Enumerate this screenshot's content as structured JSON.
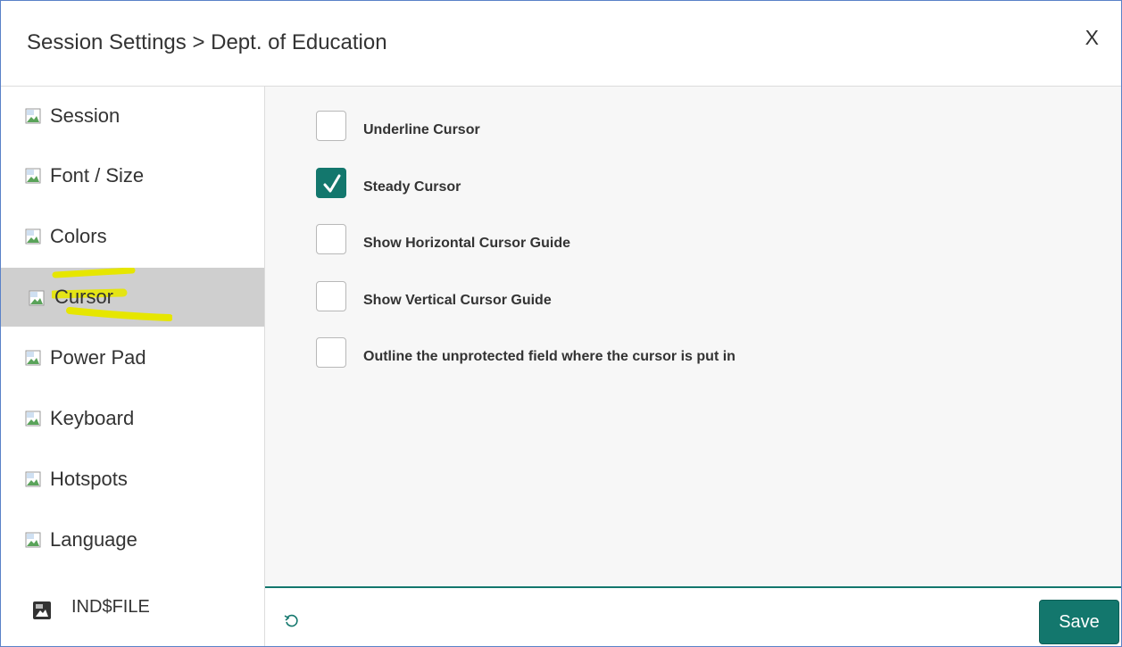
{
  "dialog": {
    "title": "Session Settings > Dept. of Education",
    "close_label": "X"
  },
  "sidebar": {
    "items": [
      {
        "label": "Session",
        "icon": "broken-image-icon"
      },
      {
        "label": "Font / Size",
        "icon": "broken-image-icon"
      },
      {
        "label": "Colors",
        "icon": "broken-image-icon"
      },
      {
        "label": "Cursor",
        "icon": "broken-image-icon",
        "active": true
      },
      {
        "label": "Power Pad",
        "icon": "broken-image-icon"
      },
      {
        "label": "Keyboard",
        "icon": "broken-image-icon"
      },
      {
        "label": "Hotspots",
        "icon": "broken-image-icon"
      },
      {
        "label": "Language",
        "icon": "broken-image-icon"
      },
      {
        "label": "IND$FILE",
        "icon": "file-transfer-icon"
      }
    ],
    "highlight_color": "#e6e600"
  },
  "cursor_options": [
    {
      "label": "Underline Cursor",
      "checked": false
    },
    {
      "label": "Steady Cursor",
      "checked": true
    },
    {
      "label": "Show Horizontal Cursor Guide",
      "checked": false
    },
    {
      "label": "Show Vertical Cursor Guide",
      "checked": false
    },
    {
      "label": "Outline the unprotected field where the cursor is put in",
      "checked": false
    }
  ],
  "footer": {
    "save_label": "Save",
    "reset_icon": "reset-icon"
  },
  "colors": {
    "accent": "#13776d",
    "active_nav": "#cfcfcf",
    "border": "#5a82c8"
  }
}
